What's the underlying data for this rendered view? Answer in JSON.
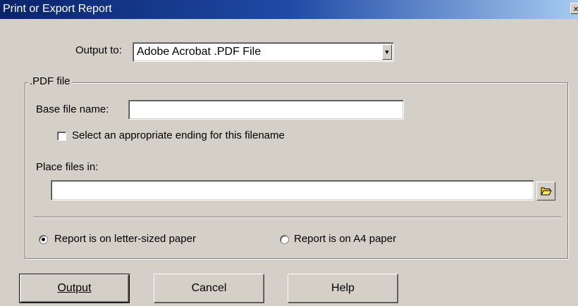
{
  "window": {
    "title": "Print or Export Report",
    "close_glyph": "×"
  },
  "output": {
    "label": "Output to:",
    "selected": "Adobe Acrobat .PDF File",
    "arrow": "▼"
  },
  "pdf_group": {
    "label": ".PDF file",
    "base_name_label": "Base file name:",
    "base_name_value": "",
    "ending_checkbox_label": "Select an appropriate ending for this filename",
    "ending_checked": false,
    "place_label": "Place files in:",
    "place_value": "",
    "browse_icon": "folder-icon",
    "paper_letter_label": "Report is on letter-sized paper",
    "paper_a4_label": "Report is on A4 paper",
    "paper_selected": "letter"
  },
  "buttons": {
    "output": "Output",
    "cancel": "Cancel",
    "help": "Help"
  },
  "colors": {
    "title_start": "#0a246a",
    "title_end": "#a6caf0",
    "face": "#d4d0c8",
    "folder": "#ffd800"
  }
}
